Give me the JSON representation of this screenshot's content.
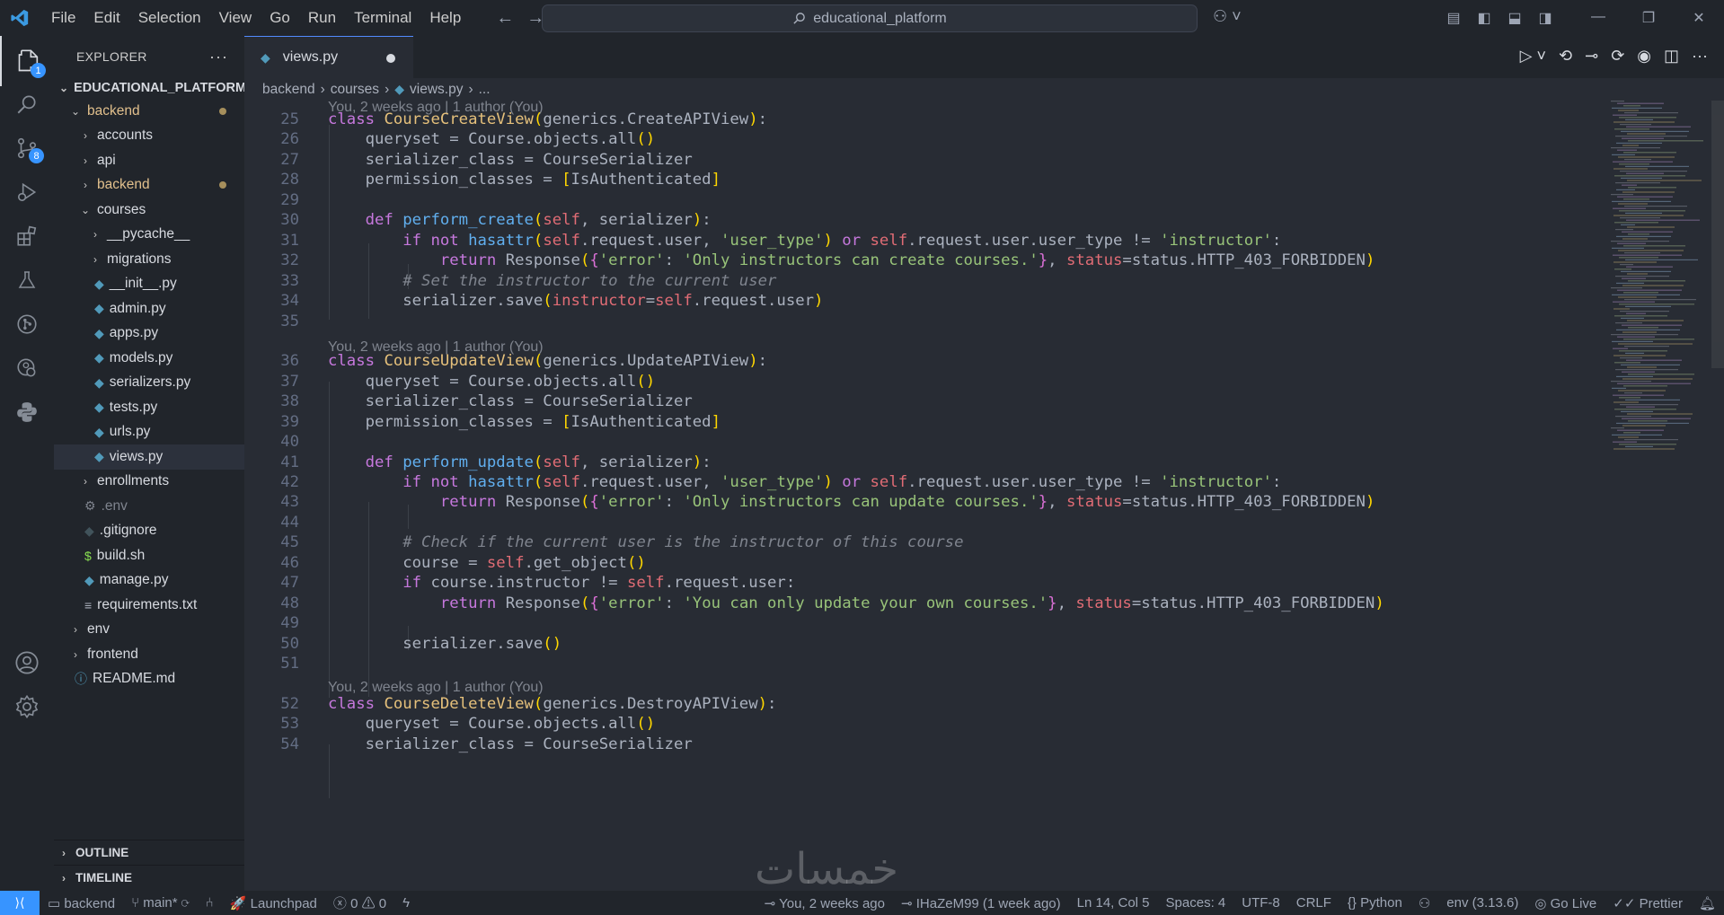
{
  "window": {
    "title": "educational_platform"
  },
  "menu": [
    "File",
    "Edit",
    "Selection",
    "View",
    "Go",
    "Run",
    "Terminal",
    "Help"
  ],
  "activity": {
    "explorer_badge": "1",
    "scm_badge": "8"
  },
  "explorer": {
    "title": "EXPLORER",
    "root": "EDUCATIONAL_PLATFORM",
    "items": [
      {
        "label": "backend",
        "type": "folder-open",
        "indent": 1,
        "modified": true
      },
      {
        "label": "accounts",
        "type": "folder",
        "indent": 2
      },
      {
        "label": "api",
        "type": "folder",
        "indent": 2
      },
      {
        "label": "backend",
        "type": "folder",
        "indent": 2,
        "modified": true
      },
      {
        "label": "courses",
        "type": "folder-open",
        "indent": 2
      },
      {
        "label": "__pycache__",
        "type": "folder",
        "indent": 3
      },
      {
        "label": "migrations",
        "type": "folder",
        "indent": 3
      },
      {
        "label": "__init__.py",
        "type": "py",
        "indent": 3
      },
      {
        "label": "admin.py",
        "type": "py",
        "indent": 3
      },
      {
        "label": "apps.py",
        "type": "py",
        "indent": 3
      },
      {
        "label": "models.py",
        "type": "py",
        "indent": 3
      },
      {
        "label": "serializers.py",
        "type": "py",
        "indent": 3
      },
      {
        "label": "tests.py",
        "type": "py",
        "indent": 3
      },
      {
        "label": "urls.py",
        "type": "py",
        "indent": 3
      },
      {
        "label": "views.py",
        "type": "py",
        "indent": 3,
        "selected": true
      },
      {
        "label": "enrollments",
        "type": "folder",
        "indent": 2
      },
      {
        "label": ".env",
        "type": "env",
        "indent": 2
      },
      {
        "label": ".gitignore",
        "type": "git",
        "indent": 2
      },
      {
        "label": "build.sh",
        "type": "sh",
        "indent": 2
      },
      {
        "label": "manage.py",
        "type": "py",
        "indent": 2
      },
      {
        "label": "requirements.txt",
        "type": "txt",
        "indent": 2
      },
      {
        "label": "env",
        "type": "folder",
        "indent": 1
      },
      {
        "label": "frontend",
        "type": "folder",
        "indent": 1
      },
      {
        "label": "README.md",
        "type": "md",
        "indent": 1
      }
    ],
    "outline": "OUTLINE",
    "timeline": "TIMELINE"
  },
  "tab": {
    "label": "views.py"
  },
  "breadcrumb": [
    "backend",
    "courses",
    "views.py",
    "..."
  ],
  "blame": {
    "top": "You, 2 weeks ago | 1 author (You)",
    "update": "You, 2 weeks ago | 1 author (You)",
    "delete": "You, 2 weeks ago | 1 author (You)"
  },
  "code_lines": {
    "25": "class CourseCreateView(generics.CreateAPIView):",
    "26": "    queryset = Course.objects.all()",
    "27": "    serializer_class = CourseSerializer",
    "28": "    permission_classes = [IsAuthenticated]",
    "29": "",
    "30": "    def perform_create(self, serializer):",
    "31": "        if not hasattr(self.request.user, 'user_type') or self.request.user.user_type != 'instructor':",
    "32": "            return Response({'error': 'Only instructors can create courses.'}, status=status.HTTP_403_FORBIDDEN)",
    "33": "        # Set the instructor to the current user",
    "34": "        serializer.save(instructor=self.request.user)",
    "35": "",
    "36": "class CourseUpdateView(generics.UpdateAPIView):",
    "37": "    queryset = Course.objects.all()",
    "38": "    serializer_class = CourseSerializer",
    "39": "    permission_classes = [IsAuthenticated]",
    "40": "",
    "41": "    def perform_update(self, serializer):",
    "42": "        if not hasattr(self.request.user, 'user_type') or self.request.user.user_type != 'instructor':",
    "43": "            return Response({'error': 'Only instructors can update courses.'}, status=status.HTTP_403_FORBIDDEN)",
    "44": "",
    "45": "        # Check if the current user is the instructor of this course",
    "46": "        course = self.get_object()",
    "47": "        if course.instructor != self.request.user:",
    "48": "            return Response({'error': 'You can only update your own courses.'}, status=status.HTTP_403_FORBIDDEN)",
    "49": "",
    "50": "        serializer.save()",
    "51": "",
    "52": "class CourseDeleteView(generics.DestroyAPIView):",
    "53": "    queryset = Course.objects.all()",
    "54": "    serializer_class = CourseSerializer"
  },
  "status": {
    "folder": "backend",
    "branch": "main*",
    "launchpad": "Launchpad",
    "errors": "0",
    "warnings": "0",
    "blame": "You, 2 weeks ago",
    "author": "IHaZeM99 (1 week ago)",
    "position": "Ln 14, Col 5",
    "spaces": "Spaces: 4",
    "encoding": "UTF-8",
    "eol": "CRLF",
    "language": "Python",
    "interpreter": "env (3.13.6)",
    "golive": "Go Live",
    "prettier": "Prettier"
  },
  "watermark": "خمسات"
}
